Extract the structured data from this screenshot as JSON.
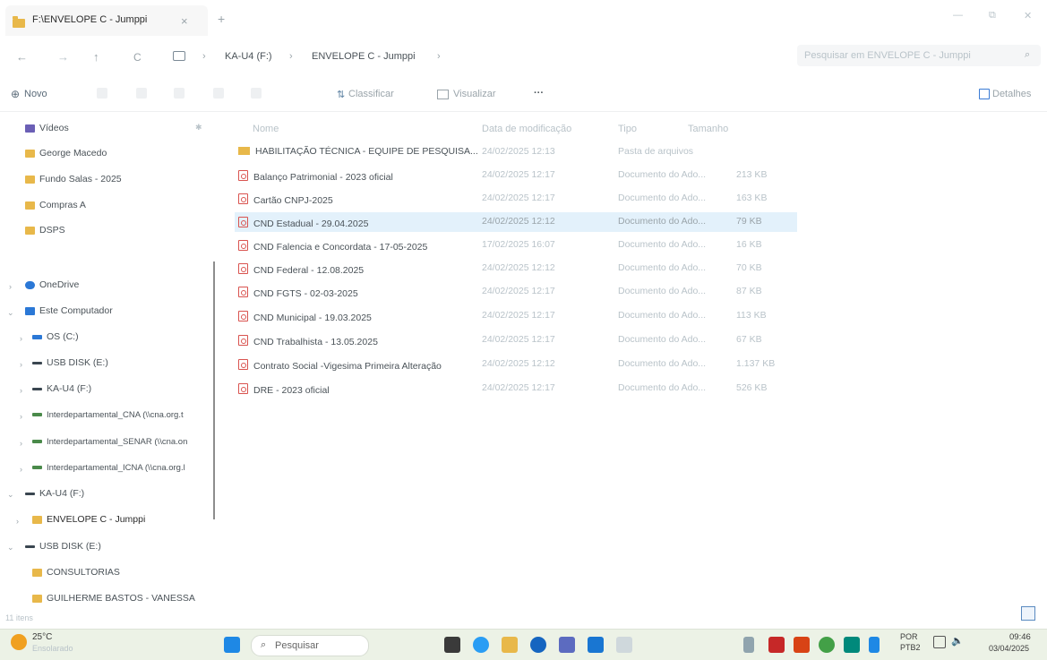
{
  "window": {
    "tab_title": "F:\\ENVELOPE C - Jumppi",
    "close_tab": "×",
    "new_tab": "+",
    "minimize": "—",
    "restore": "⧉",
    "close": "✕"
  },
  "nav": {
    "back": "←",
    "forward": "→",
    "up": "↑",
    "refresh": "C"
  },
  "breadcrumb": [
    "KA-U4 (F:)",
    "ENVELOPE C - Jumppi"
  ],
  "search": {
    "placeholder": "Pesquisar em ENVELOPE C - Jumppi"
  },
  "toolbar": {
    "new_label": "Novo",
    "sort_label": "Classificar",
    "view_label": "Visualizar",
    "more_label": "···",
    "details_label": "Detalhes"
  },
  "sidebar": {
    "quick": [
      "Vídeos",
      "George Macedo",
      "Fundo Salas - 2025",
      "Compras A",
      "DSPS"
    ],
    "onedrive": "OneDrive",
    "this_pc": "Este Computador",
    "drives": [
      "OS (C:)",
      "USB DISK (E:)",
      "KA-U4 (F:)",
      "Interdepartamental_CNA (\\\\cna.org.t",
      "Interdepartamental_SENAR (\\\\cna.on",
      "Interdepartamental_ICNA (\\\\cna.org.l"
    ],
    "ka_u4": "KA-U4 (F:)",
    "envelope": "ENVELOPE C - Jumppi",
    "usb": "USB DISK (E:)",
    "usb_children": [
      "CONSULTORIAS",
      "GUILHERME BASTOS - VANESSA"
    ]
  },
  "columns": {
    "name": "Nome",
    "date": "Data de modificação",
    "type": "Tipo",
    "size": "Tamanho"
  },
  "files": [
    {
      "name": "HABILITAÇÃO TÉCNICA - EQUIPE DE PESQUISA...",
      "date": "24/02/2025 12:13",
      "type": "Pasta de arquivos",
      "size": "",
      "kind": "folder"
    },
    {
      "name": "Balanço Patrimonial - 2023 oficial",
      "date": "24/02/2025 12:17",
      "type": "Documento do Ado...",
      "size": "213 KB",
      "kind": "pdf"
    },
    {
      "name": "Cartão CNPJ-2025",
      "date": "24/02/2025 12:17",
      "type": "Documento do Ado...",
      "size": "163 KB",
      "kind": "pdf"
    },
    {
      "name": "CND Estadual - 29.04.2025",
      "date": "24/02/2025 12:12",
      "type": "Documento do Ado...",
      "size": "79 KB",
      "kind": "pdf"
    },
    {
      "name": "CND Falencia e Concordata - 17-05-2025",
      "date": "17/02/2025 16:07",
      "type": "Documento do Ado...",
      "size": "16 KB",
      "kind": "pdf"
    },
    {
      "name": "CND Federal - 12.08.2025",
      "date": "24/02/2025 12:12",
      "type": "Documento do Ado...",
      "size": "70 KB",
      "kind": "pdf"
    },
    {
      "name": "CND FGTS - 02-03-2025",
      "date": "24/02/2025 12:17",
      "type": "Documento do Ado...",
      "size": "87 KB",
      "kind": "pdf"
    },
    {
      "name": "CND Municipal - 19.03.2025",
      "date": "24/02/2025 12:17",
      "type": "Documento do Ado...",
      "size": "113 KB",
      "kind": "pdf"
    },
    {
      "name": "CND Trabalhista - 13.05.2025",
      "date": "24/02/2025 12:17",
      "type": "Documento do Ado...",
      "size": "67 KB",
      "kind": "pdf"
    },
    {
      "name": "Contrato Social -Vigesima Primeira Alteração",
      "date": "24/02/2025 12:12",
      "type": "Documento do Ado...",
      "size": "1.137 KB",
      "kind": "pdf"
    },
    {
      "name": "DRE - 2023 oficial",
      "date": "24/02/2025 12:17",
      "type": "Documento do Ado...",
      "size": "526 KB",
      "kind": "pdf"
    }
  ],
  "status": {
    "items": "11 itens"
  },
  "taskbar": {
    "weather_temp": "25°C",
    "weather_desc": "Ensolarado",
    "search_placeholder": "Pesquisar",
    "lang": "POR",
    "layout": "PTB2",
    "time": "09:46",
    "date": "03/04/2025"
  },
  "colors": {
    "accent": "#0067c0",
    "selection": "#e3f1fb",
    "folder": "#e8b84a",
    "pdf": "#d9534f",
    "taskbar": "#ecf2e6"
  }
}
